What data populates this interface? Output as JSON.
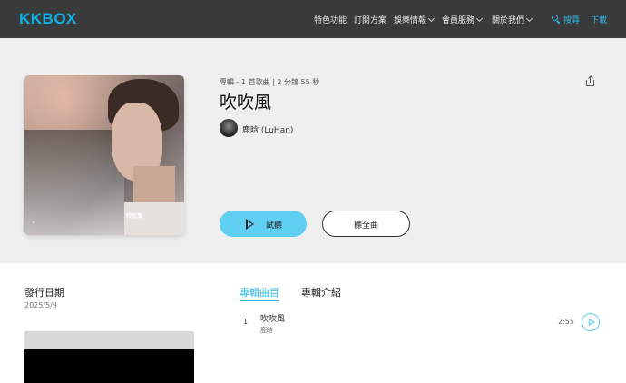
{
  "header": {
    "logo": "KKBOX",
    "nav": {
      "features": "特色功能",
      "plans": "訂閱方案",
      "news": "娛樂情報",
      "member": "會員服務",
      "about": "關於我們",
      "search": "搜尋",
      "download": "下載"
    }
  },
  "album": {
    "meta": "專輯 - 1 首歌曲 | 2 分鐘 55 秒",
    "title": "吹吹風",
    "artist": "鹿晗 (LuHan)",
    "cover_text": "吹吹風"
  },
  "buttons": {
    "preview": "試聽",
    "full": "聽全曲"
  },
  "release": {
    "label": "發行日期",
    "date": "2025/5/9"
  },
  "tabs": {
    "tracks": "專輯曲目",
    "intro": "專輯介紹"
  },
  "tracks": [
    {
      "num": "1",
      "title": "吹吹風",
      "artist": "鹿晗",
      "duration": "2:55"
    }
  ],
  "colors": {
    "accent": "#2bb8e8",
    "button": "#5fd0f3",
    "nav_bg": "#3a3a3a",
    "hero_bg": "#efefef"
  }
}
